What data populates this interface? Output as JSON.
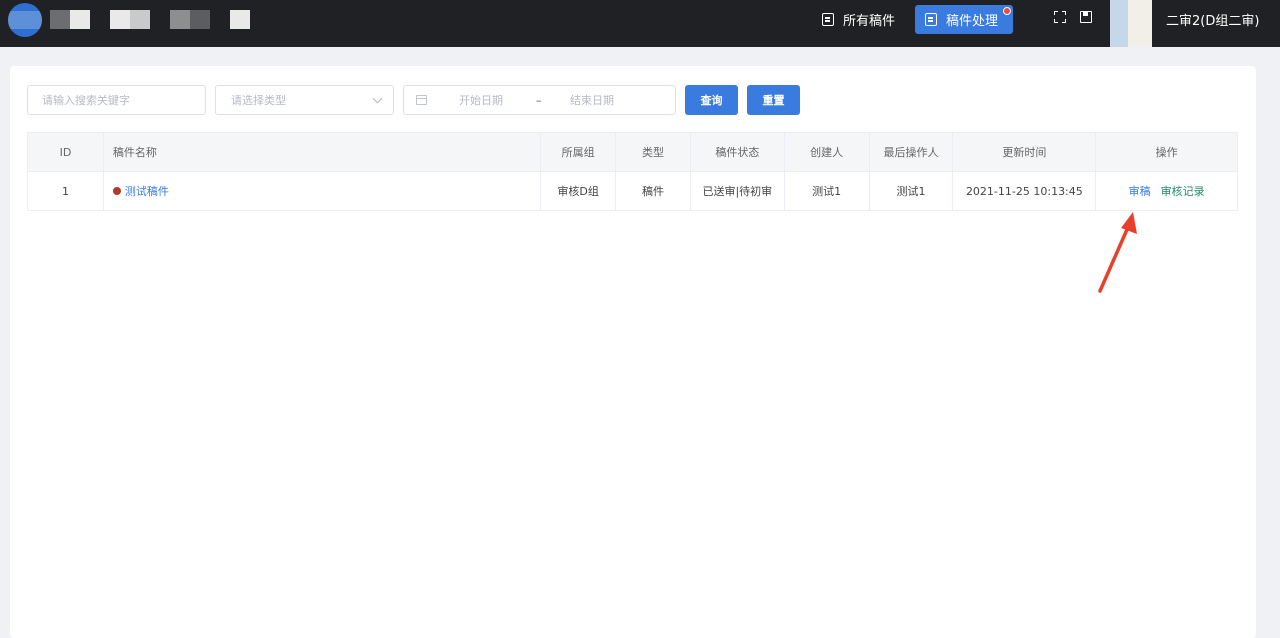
{
  "header": {
    "nav": [
      {
        "label": "所有稿件",
        "icon": "document-icon"
      },
      {
        "label": "稿件处理",
        "icon": "edit-document-icon",
        "active": true
      }
    ],
    "user": "二审2(D组二审)"
  },
  "filters": {
    "keyword_placeholder": "请输入搜索关键字",
    "type_placeholder": "请选择类型",
    "start_date_placeholder": "开始日期",
    "date_separator": "–",
    "end_date_placeholder": "结束日期",
    "query_label": "查询",
    "reset_label": "重置"
  },
  "table": {
    "headers": [
      "ID",
      "稿件名称",
      "所属组",
      "类型",
      "稿件状态",
      "创建人",
      "最后操作人",
      "更新时间",
      "操作"
    ],
    "rows": [
      {
        "id": "1",
        "name": "测试稿件",
        "group": "审核D组",
        "type": "稿件",
        "status": "已送审|待初审",
        "creator": "测试1",
        "last_operator": "测试1",
        "updated": "2021-11-25 10:13:45",
        "actions": [
          "审稿",
          "审核记录"
        ]
      }
    ]
  },
  "colors": {
    "topbar": "#1f2124",
    "accent": "#3a7be0",
    "link_green": "#1f8a6a",
    "status_dot": "#b03a2e",
    "arrow": "#e8402a"
  }
}
